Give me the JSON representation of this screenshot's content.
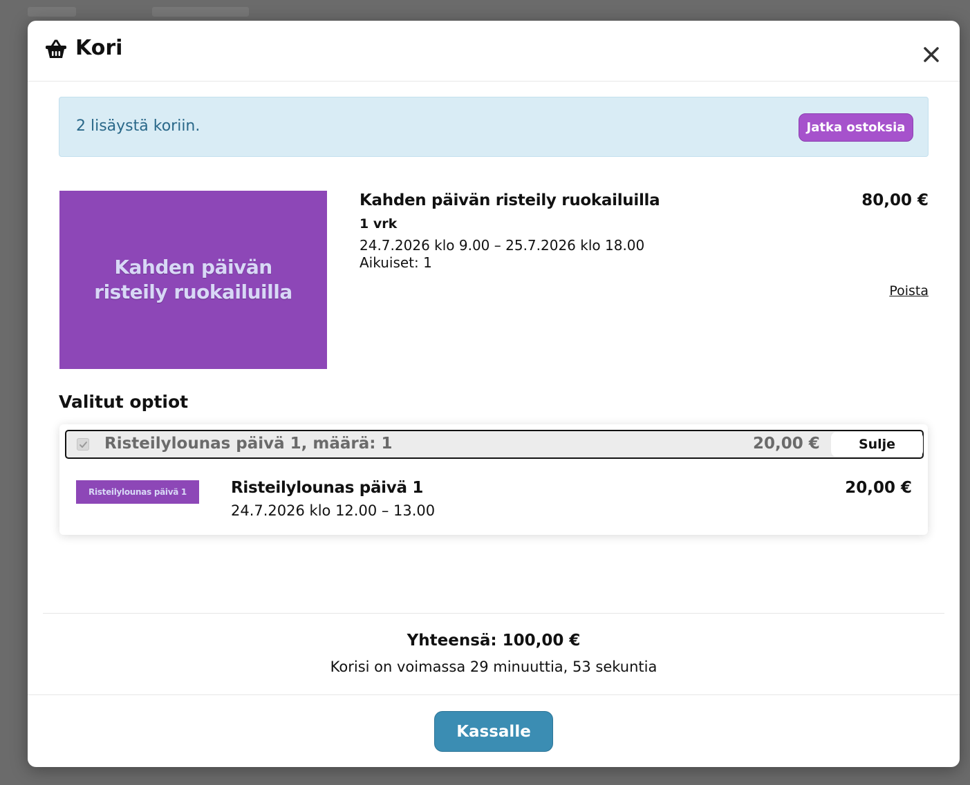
{
  "modal": {
    "title": "Kori",
    "basket_icon": "basket-icon",
    "close_icon": "close-icon"
  },
  "alert": {
    "message": "2 lisäystä koriin.",
    "continue_label": "Jatka ostoksia"
  },
  "product": {
    "image_text": "Kahden päivän risteily ruokailuilla",
    "name": "Kahden päivän risteily ruokailuilla",
    "duration": "1 vrk",
    "dates": "24.7.2026 klo 9.00 – 25.7.2026 klo 18.00",
    "guests": "Aikuiset: 1",
    "price": "80,00 €",
    "remove_label": "Poista"
  },
  "options": {
    "heading": "Valitut optiot",
    "summary_label": "Risteilylounas päivä 1, määrä: 1",
    "summary_price": "20,00 €",
    "close_label": "Sulje",
    "checked": true,
    "item": {
      "thumb_text": "Risteilylounas päivä 1",
      "name": "Risteilylounas päivä 1",
      "dates": "24.7.2026 klo 12.00 – 13.00",
      "price": "20,00 €"
    }
  },
  "footer": {
    "total": "Yhteensä: 100,00 €",
    "timer": "Korisi on voimassa 29 minuuttia, 53 sekuntia",
    "checkout_label": "Kassalle"
  },
  "colors": {
    "accent_purple": "#a652cc",
    "image_purple": "#8d47b7",
    "alert_bg": "#d9ecf5",
    "alert_text": "#2a6889",
    "checkout_blue": "#3b8db3"
  }
}
